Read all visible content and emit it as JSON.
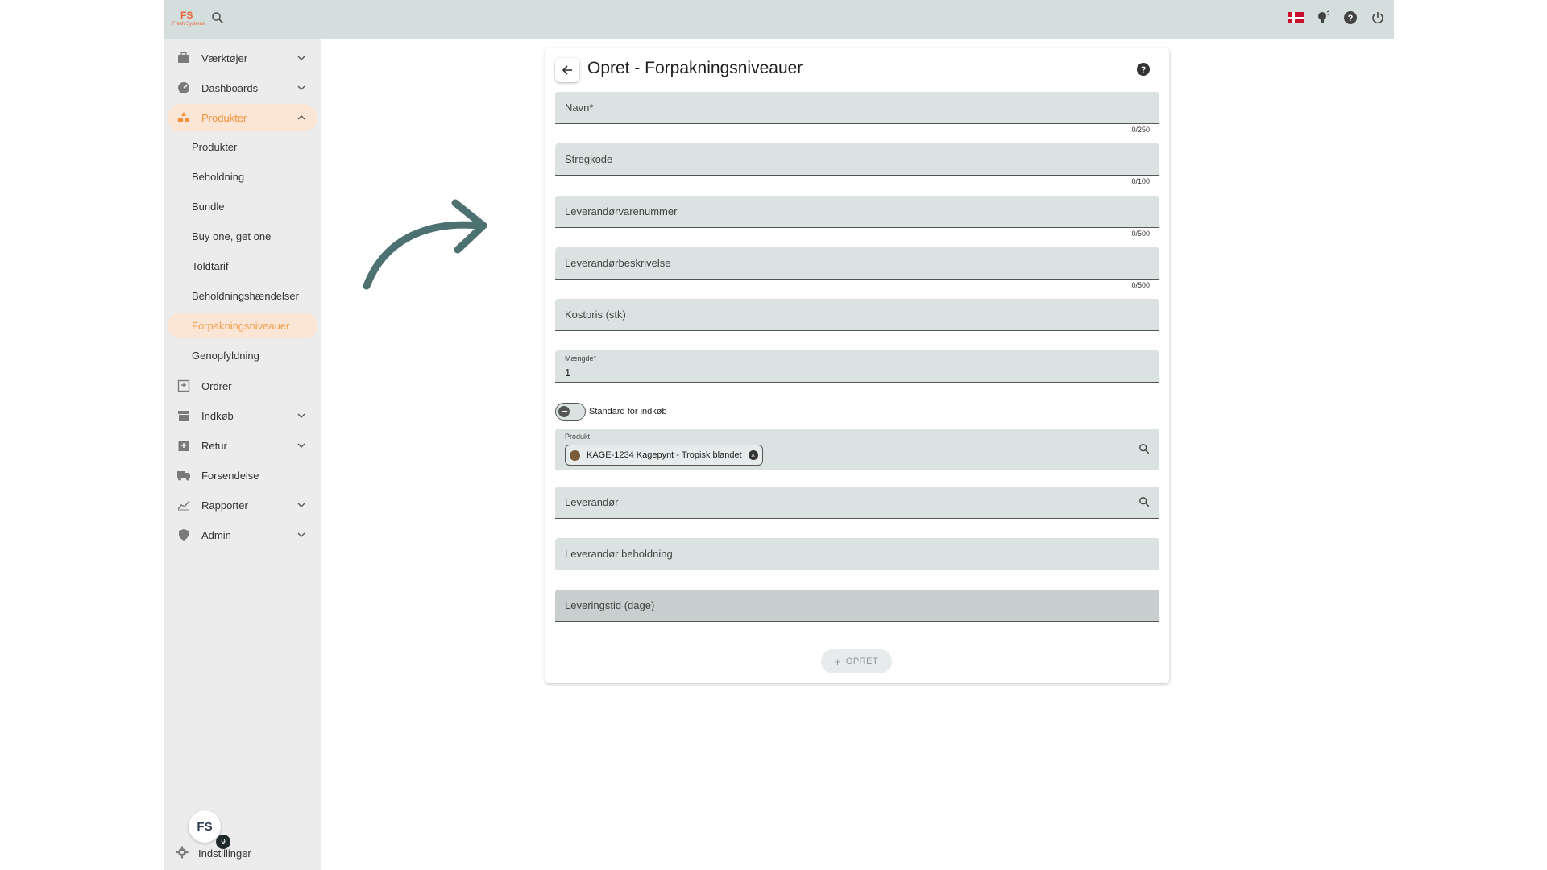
{
  "sidebar": {
    "items": [
      {
        "label": "Værktøjer",
        "icon": "toolbox-icon",
        "chevron": "down"
      },
      {
        "label": "Dashboards",
        "icon": "speedometer-icon",
        "chevron": "down"
      },
      {
        "label": "Produkter",
        "icon": "shapes-icon",
        "chevron": "up"
      },
      {
        "label": "Ordrer",
        "icon": "inbox-icon"
      },
      {
        "label": "Indkøb",
        "icon": "store-icon",
        "chevron": "down"
      },
      {
        "label": "Retur",
        "icon": "return-box-icon",
        "chevron": "down"
      },
      {
        "label": "Forsendelse",
        "icon": "truck-icon"
      },
      {
        "label": "Rapporter",
        "icon": "chart-icon",
        "chevron": "down"
      },
      {
        "label": "Admin",
        "icon": "admin-shield-icon",
        "chevron": "down"
      }
    ],
    "sub_items": [
      "Produkter",
      "Beholdning",
      "Bundle",
      "Buy one, get one",
      "Toldtarif",
      "Beholdningshændelser",
      "Forpakningsniveauer",
      "Genopfyldning"
    ],
    "settings_label": "Indstillinger",
    "badge_count": "9",
    "fs_logo_text": "FS"
  },
  "header": {
    "logo_text": "FS",
    "logo_sub": "Fresh Systems"
  },
  "form": {
    "title": "Opret - Forpakningsniveauer",
    "fields": {
      "navn": {
        "label": "Navn*",
        "counter": "0/250"
      },
      "stregkode": {
        "label": "Stregkode",
        "counter": "0/100"
      },
      "leverandorvarenummer": {
        "label": "Leverandørvarenummer",
        "counter": "0/500"
      },
      "leverandorbeskrivelse": {
        "label": "Leverandørbeskrivelse",
        "counter": "0/500"
      },
      "kostpris": {
        "label": "Kostpris (stk)"
      },
      "maengde": {
        "label": "Mængde*",
        "value": "1"
      },
      "standard": {
        "label": "Standard for indkøb"
      },
      "produkt": {
        "label": "Produkt",
        "chip": "KAGE-1234 Kagepynt - Tropisk blandet"
      },
      "leverandor": {
        "label": "Leverandør"
      },
      "leverandor_beholdning": {
        "label": "Leverandør beholdning"
      },
      "leveringstid": {
        "label": "Leveringstid (dage)"
      }
    },
    "create_label": "OPRET"
  },
  "colors": {
    "accent": "#f0913d",
    "field_bg": "#dae3e2",
    "topbar": "#d3dedd",
    "arrow": "#4d7070"
  }
}
